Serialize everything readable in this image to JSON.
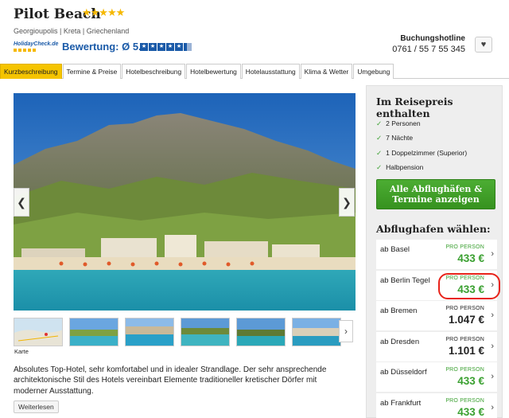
{
  "hotel": {
    "name": "Pilot Beach",
    "stars": "★★★★★",
    "location": "Georgioupolis | Kreta | Griechenland",
    "holidaycheck_logo": "HolidayCheck.de",
    "rating_label": "Bewertung:  Ø 5.4"
  },
  "hotline": {
    "title": "Buchungshotline",
    "number": "0761 / 55 7 55 345"
  },
  "icons": {
    "favorite": "heart-icon",
    "prev": "chevron-left-icon",
    "next": "chevron-right-icon",
    "check": "check-icon"
  },
  "glyphs": {
    "heart": "♥",
    "left": "❮",
    "right": "❯",
    "check": "✓",
    "chevron": "›"
  },
  "tabs": [
    {
      "label": "Kurzbeschreibung",
      "active": true
    },
    {
      "label": "Termine & Preise"
    },
    {
      "label": "Hotelbeschreibung"
    },
    {
      "label": "Hotelbewertung"
    },
    {
      "label": "Hotelausstattung"
    },
    {
      "label": "Klima & Wetter"
    },
    {
      "label": "Umgebung"
    }
  ],
  "gallery": {
    "map_label": "Karte"
  },
  "description": {
    "text": "Absolutes Top-Hotel, sehr komfortabel und in idealer Strandlage. Der sehr ansprechende architektonische Stil des Hotels vereinbart Elemente traditioneller kretischer Dörfer mit moderner Ausstattung.",
    "more_label": "Weiterlesen"
  },
  "sidebar": {
    "included_title": "Im Reisepreis enthalten",
    "included": [
      "2 Personen",
      "7 Nächte",
      "1 Doppelzimmer (Superior)",
      "Halbpension"
    ],
    "cta_line1": "Alle Abflughäfen &",
    "cta_line2": "Termine anzeigen",
    "airports_title": "Abflughafen wählen:",
    "airports": [
      {
        "name": "ab Basel",
        "pp": "PRO PERSON",
        "price": "433 €",
        "highlight_color": "green"
      },
      {
        "name": "ab Berlin Tegel",
        "pp": "PRO PERSON",
        "price": "433 €",
        "highlight_color": "green"
      },
      {
        "name": "ab Bremen",
        "pp": "PRO PERSON",
        "price": "1.047 €",
        "highlight_color": "dark"
      },
      {
        "name": "ab Dresden",
        "pp": "PRO PERSON",
        "price": "1.101 €",
        "highlight_color": "dark"
      },
      {
        "name": "ab Düsseldorf",
        "pp": "PRO PERSON",
        "price": "433 €",
        "highlight_color": "green"
      },
      {
        "name": "ab Frankfurt",
        "pp": "PRO PERSON",
        "price": "433 €",
        "highlight_color": "green"
      }
    ]
  },
  "colors": {
    "accent_tab": "#f5c400",
    "cta_green": "#3aa030",
    "brand_blue": "#1a5aa8",
    "highlight_red": "#e8231a"
  }
}
